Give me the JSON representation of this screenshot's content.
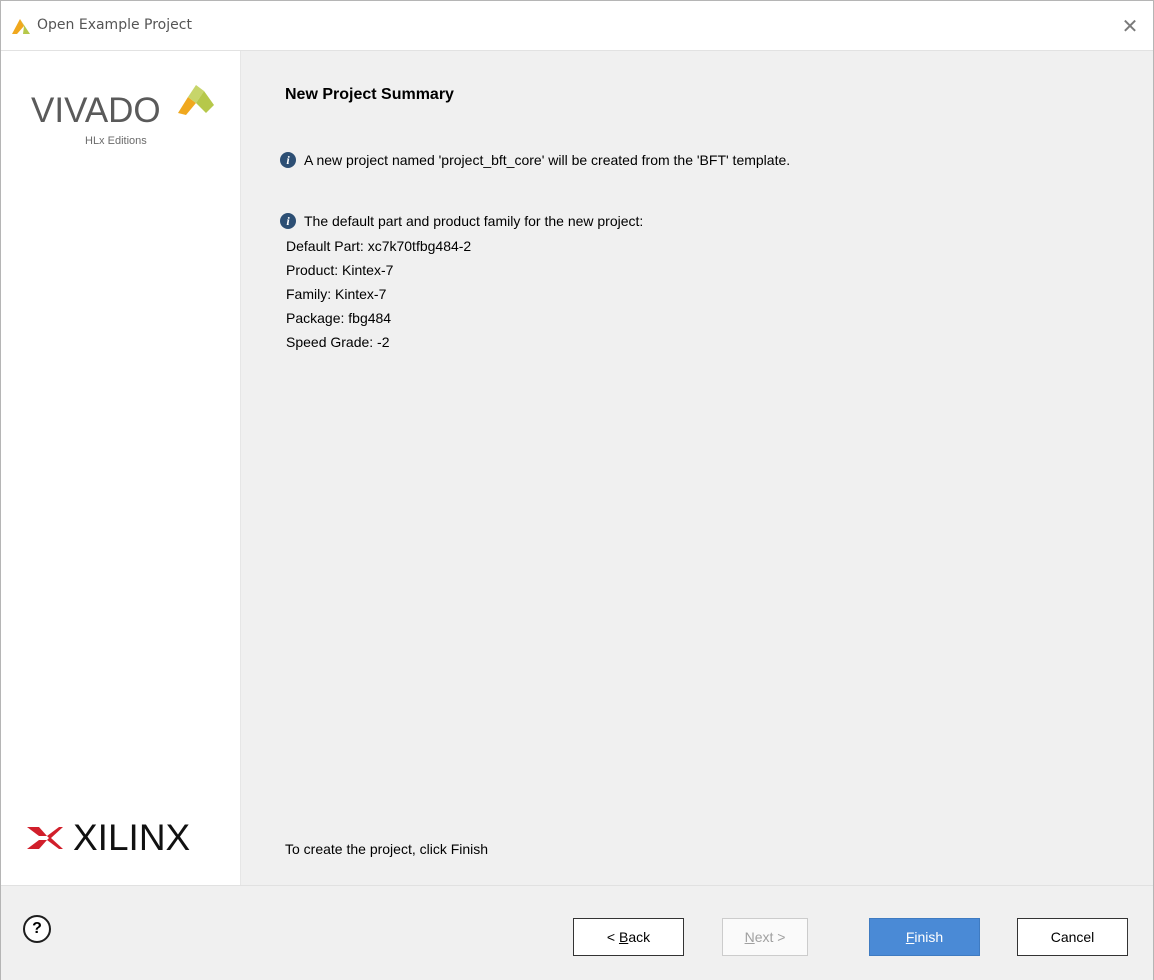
{
  "window": {
    "title": "Open Example Project",
    "close_glyph": "✕"
  },
  "branding": {
    "product_word": "VIVADO",
    "edition": "HLx Editions",
    "company_word": "XILINX",
    "mark_color_light": "#b6c84a",
    "mark_color_dark": "#f0a81e"
  },
  "main": {
    "heading": "New Project Summary",
    "info_message": "A new project named 'project_bft_core' will be created from the 'BFT' template.",
    "part_info_header": "The default part and product family for the new project:",
    "part_details": [
      "Default Part: xc7k70tfbg484-2",
      "Product: Kintex-7",
      "Family: Kintex-7",
      "Package: fbg484",
      "Speed Grade: -2"
    ],
    "footer_hint": "To create the project, click Finish",
    "info_icon_glyph": "i"
  },
  "buttons": {
    "help_glyph": "?",
    "back_prefix": "< ",
    "back_mnemonic": "B",
    "back_rest": "ack",
    "next_mnemonic": "N",
    "next_rest": "ext >",
    "finish_mnemonic": "F",
    "finish_rest": "inish",
    "cancel": "Cancel"
  },
  "colors": {
    "finish_accent": "#4a8ad6",
    "info_icon": "#2d4f74"
  }
}
